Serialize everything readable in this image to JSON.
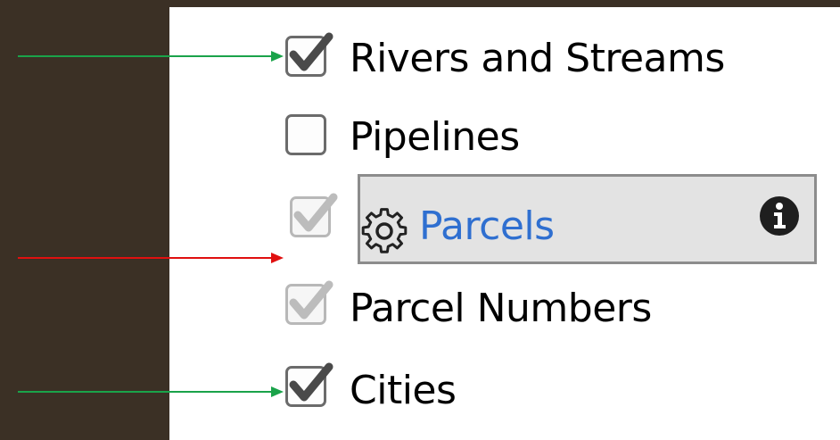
{
  "layers": [
    {
      "label": "Rivers and Streams",
      "checked": true,
      "dimmed": false
    },
    {
      "label": "Pipelines",
      "checked": false,
      "dimmed": false
    },
    {
      "label": "Parcels",
      "checked": true,
      "dimmed": true,
      "selected": true
    },
    {
      "label": "Parcel Numbers",
      "checked": true,
      "dimmed": true
    },
    {
      "label": "Cities",
      "checked": true,
      "dimmed": false
    }
  ],
  "colors": {
    "background_dark": "#3b3025",
    "panel": "#ffffff",
    "selected_row": "#e3e3e3",
    "selected_text": "#2f6fd0",
    "arrow_green": "#1aa34a",
    "arrow_red": "#e01010"
  },
  "icons": {
    "gear": "gear-icon",
    "info": "info-icon",
    "check": "checkmark-icon"
  },
  "annotations": [
    {
      "color": "green",
      "target": "Rivers and Streams"
    },
    {
      "color": "red",
      "target": "Parcels"
    },
    {
      "color": "green",
      "target": "Cities"
    }
  ]
}
